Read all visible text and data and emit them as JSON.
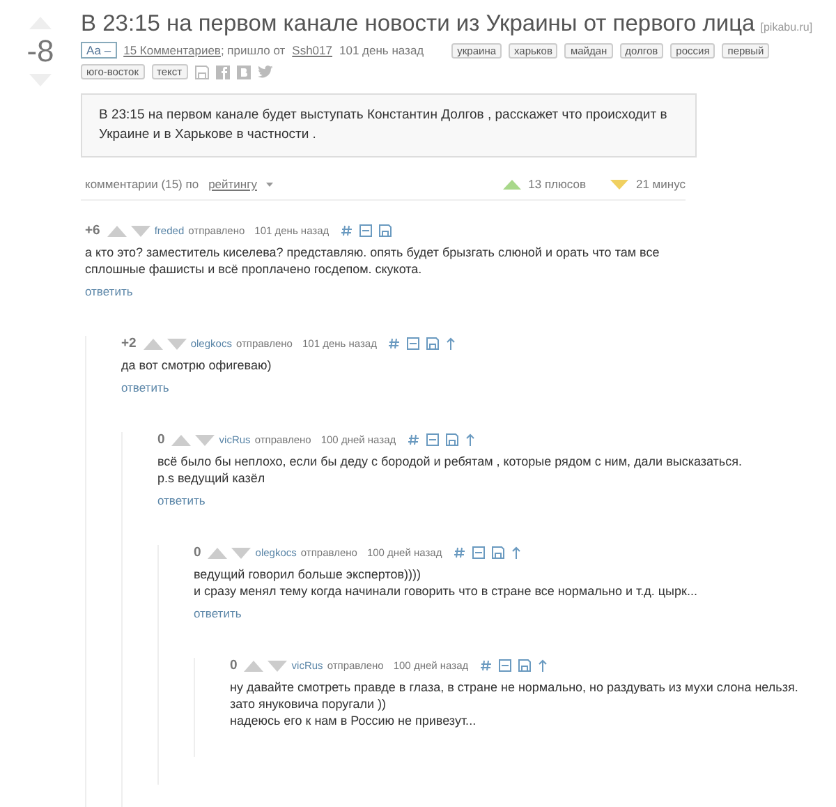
{
  "post": {
    "rating": "-8",
    "title": "В 23:15 на первом канале новости из Украины от первого лица",
    "source": "[pikabu.ru]",
    "font_toggle": "Аа –",
    "comments_link": "15 Комментариев",
    "came_from": "; пришло от",
    "author": "Ssh017",
    "time": "101 день назад",
    "tags": [
      "украина",
      "харьков",
      "майдан",
      "долгов",
      "россия",
      "первый",
      "юго-восток",
      "текст"
    ],
    "body": "В 23:15 на первом канале будет выступать Константин Долгов , расскажет что происходит в Украине и в Харькове в частности ."
  },
  "comments_bar": {
    "label": "комментарии (15) по",
    "sort": "рейтингу",
    "pluses": "13 плюсов",
    "minuses": "21 минус"
  },
  "comments": [
    {
      "score": "+6",
      "author": "freded",
      "sent": "отправлено",
      "time": "101 день назад",
      "text": "а кто это? заместитель киселева? представляю. опять будет брызгать слюной и орать что там все сплошные фашисты и всё проплачено госдепом. скукота.",
      "reply": "ответить",
      "children": [
        {
          "score": "+2",
          "author": "olegkocs",
          "sent": "отправлено",
          "time": "101 день назад",
          "text": "да вот смотрю офигеваю)",
          "reply": "ответить",
          "children": [
            {
              "score": "0",
              "author": "vicRus",
              "sent": "отправлено",
              "time": "100 дней назад",
              "text": "всё было бы неплохо, если бы деду с бородой и ребятам , которые рядом с ним, дали высказаться.\np.s ведущий казёл",
              "reply": "ответить",
              "children": [
                {
                  "score": "0",
                  "author": "olegkocs",
                  "sent": "отправлено",
                  "time": "100 дней назад",
                  "text": "ведущий говорил больше экспертов))))\nи сразу менял тему когда начинали говорить что в стране все нормально и т.д. цырк...",
                  "reply": "ответить",
                  "children": [
                    {
                      "score": "0",
                      "author": "vicRus",
                      "sent": "отправлено",
                      "time": "100 дней назад",
                      "text": "ну давайте смотреть правде в глаза, в стране не нормально, но раздувать из мухи слона нельзя.\nзато януковича поругали ))\nнадеюсь его к нам в Россию не привезут..."
                    }
                  ]
                }
              ]
            }
          ]
        }
      ]
    }
  ]
}
